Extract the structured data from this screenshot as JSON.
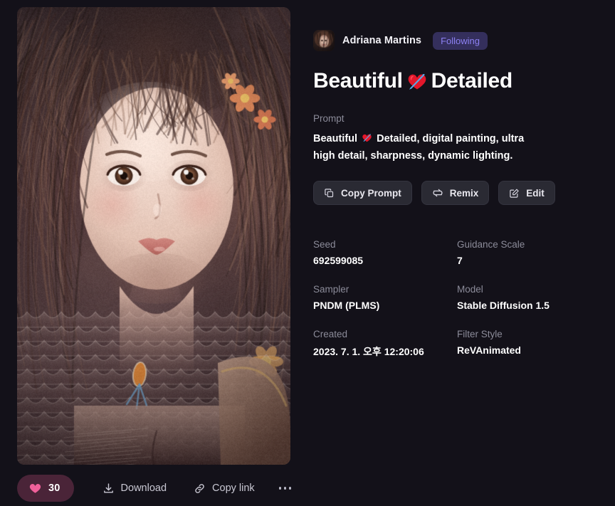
{
  "background_color": "#131119",
  "artwork": {
    "alt": "portrait-illustration",
    "icon": "artwork-image"
  },
  "author": {
    "name": "Adriana Martins",
    "follow_state": "Following",
    "avatar_icon": "avatar"
  },
  "title": {
    "before": "Beautiful",
    "emoji": "heart-with-arrow",
    "after": "Detailed"
  },
  "prompt": {
    "label": "Prompt",
    "before": "Beautiful",
    "emoji": "heart-with-arrow",
    "after": "Detailed, digital painting, ultra high detail, sharpness, dynamic lighting."
  },
  "actions": {
    "copy_prompt": "Copy Prompt",
    "remix": "Remix",
    "edit": "Edit"
  },
  "metadata": [
    {
      "label": "Seed",
      "value": "692599085"
    },
    {
      "label": "Guidance Scale",
      "value": "7"
    },
    {
      "label": "Sampler",
      "value": "PNDM (PLMS)"
    },
    {
      "label": "Model",
      "value": "Stable Diffusion 1.5"
    },
    {
      "label": "Created",
      "value": "2023. 7. 1. 오후 12:20:06"
    },
    {
      "label": "Filter Style",
      "value": "ReVAnimated"
    }
  ],
  "bottom_bar": {
    "like_count": "30",
    "download": "Download",
    "copy_link": "Copy link",
    "more": "more-options"
  },
  "colors": {
    "like_pill_bg": "#4a2438",
    "like_heart": "#f0609a",
    "following_bg": "#342f5c",
    "following_text": "#8c80f2",
    "button_bg": "#2a2a33",
    "label_text": "#8b8b99"
  }
}
